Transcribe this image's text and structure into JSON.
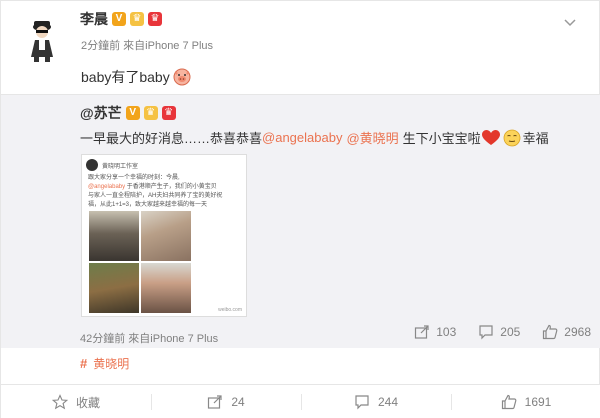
{
  "post": {
    "author": "李晨",
    "badges": {
      "verified": "V",
      "vip": "♛",
      "gold": "♛"
    },
    "meta": "2分鐘前 來自iPhone 7 Plus",
    "text": "baby有了baby",
    "emoji": "pig-emoji"
  },
  "repost": {
    "author": "@苏芒",
    "text_before": "一早最大的好消息……恭喜恭喜",
    "mention1": "@angelababy",
    "mention2": "@黄晓明",
    "text_after": "生下小宝宝啦",
    "text_end": "幸福",
    "screenshot": {
      "account": "黄晓明工作室",
      "line_a": "跟大家分享一个幸福的时刻：今晨,",
      "mention": "@angelababy",
      "line_b": "于香港顺产生子，我们的小黄宝贝",
      "line_c": "与家人一直全程陪护，AH夫妇共同养了宝的美好祝",
      "line_d": "福，从此1+1=3，致大家越来越幸福的每一天",
      "watermark": "weibo.com"
    },
    "meta": "42分鐘前 來自iPhone 7 Plus",
    "repost_count": "103",
    "comment_count": "205",
    "like_count": "2968"
  },
  "topic": {
    "label": "黄晓明"
  },
  "footer": {
    "favorite": "收藏",
    "repost": "24",
    "comment": "244",
    "like": "1691"
  },
  "colors": {
    "link": "#eb7350",
    "mention_blue": "#2d6ab4",
    "repost_bg": "#f2f2f5",
    "meta_gray": "#808080"
  }
}
